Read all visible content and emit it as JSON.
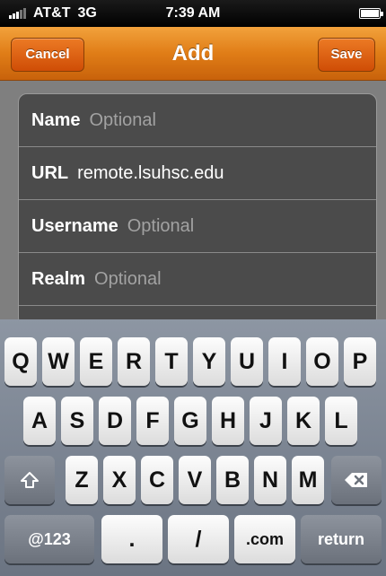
{
  "status_bar": {
    "carrier": "AT&T",
    "network": "3G",
    "time": "7:39 AM"
  },
  "nav": {
    "title": "Add",
    "cancel_label": "Cancel",
    "save_label": "Save"
  },
  "form": {
    "fields": [
      {
        "label": "Name",
        "value": "",
        "placeholder": "Optional"
      },
      {
        "label": "URL",
        "value": "remote.lsuhsc.edu",
        "placeholder": ""
      },
      {
        "label": "Username",
        "value": "",
        "placeholder": "Optional"
      },
      {
        "label": "Realm",
        "value": "",
        "placeholder": "Optional"
      }
    ]
  },
  "keyboard": {
    "row1": [
      "Q",
      "W",
      "E",
      "R",
      "T",
      "Y",
      "U",
      "I",
      "O",
      "P"
    ],
    "row2": [
      "A",
      "S",
      "D",
      "F",
      "G",
      "H",
      "J",
      "K",
      "L"
    ],
    "row3": [
      "Z",
      "X",
      "C",
      "V",
      "B",
      "N",
      "M"
    ],
    "bottom": {
      "numbers_label": "@123",
      "dot_label": ".",
      "slash_label": "/",
      "dotcom_label": ".com",
      "return_label": "return"
    },
    "icons": {
      "shift": "shift-arrow-icon",
      "delete": "backspace-icon"
    }
  }
}
